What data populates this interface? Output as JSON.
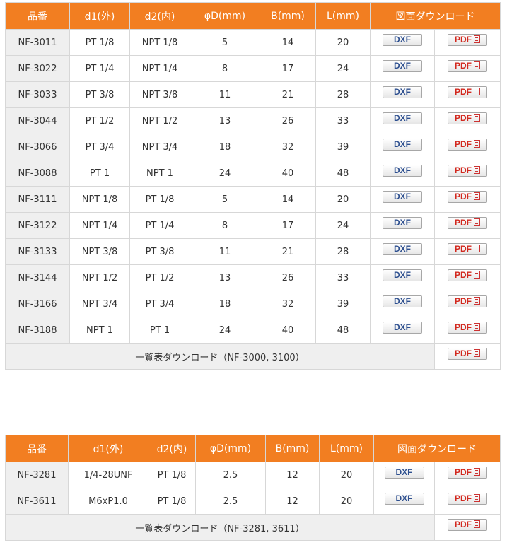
{
  "table1": {
    "headers": [
      "品番",
      "d1(外)",
      "d2(内)",
      "φD(mm)",
      "B(mm)",
      "L(mm)",
      "図面ダウンロード"
    ],
    "rows": [
      [
        "NF-3011",
        "PT 1/8",
        "NPT 1/8",
        "5",
        "14",
        "20"
      ],
      [
        "NF-3022",
        "PT 1/4",
        "NPT 1/4",
        "8",
        "17",
        "24"
      ],
      [
        "NF-3033",
        "PT 3/8",
        "NPT 3/8",
        "11",
        "21",
        "28"
      ],
      [
        "NF-3044",
        "PT 1/2",
        "NPT 1/2",
        "13",
        "26",
        "33"
      ],
      [
        "NF-3066",
        "PT 3/4",
        "NPT 3/4",
        "18",
        "32",
        "39"
      ],
      [
        "NF-3088",
        "PT 1",
        "NPT 1",
        "24",
        "40",
        "48"
      ],
      [
        "NF-3111",
        "NPT 1/8",
        "PT 1/8",
        "5",
        "14",
        "20"
      ],
      [
        "NF-3122",
        "NPT 1/4",
        "PT 1/4",
        "8",
        "17",
        "24"
      ],
      [
        "NF-3133",
        "NPT 3/8",
        "PT 3/8",
        "11",
        "21",
        "28"
      ],
      [
        "NF-3144",
        "NPT 1/2",
        "PT 1/2",
        "13",
        "26",
        "33"
      ],
      [
        "NF-3166",
        "NPT 3/4",
        "PT 3/4",
        "18",
        "32",
        "39"
      ],
      [
        "NF-3188",
        "NPT 1",
        "PT 1",
        "24",
        "40",
        "48"
      ]
    ],
    "footer_label": "一覧表ダウンロード（NF-3000, 3100）"
  },
  "table2": {
    "headers": [
      "品番",
      "d1(外)",
      "d2(内)",
      "φD(mm)",
      "B(mm)",
      "L(mm)",
      "図面ダウンロード"
    ],
    "rows": [
      [
        "NF-3281",
        "1/4-28UNF",
        "PT 1/8",
        "2.5",
        "12",
        "20"
      ],
      [
        "NF-3611",
        "M6xP1.0",
        "PT 1/8",
        "2.5",
        "12",
        "20"
      ]
    ],
    "footer_label": "一覧表ダウンロード（NF-3281, 3611）"
  },
  "buttons": {
    "dxf": "DXF",
    "pdf": "PDF"
  },
  "icons": {
    "pdf": "pdf-file-icon"
  },
  "colors": {
    "header_bg": "#f27e21",
    "header_text": "#ffffff",
    "border": "#d7d7d7",
    "stripe": "#efefef",
    "dxf_text": "#2d4f8f",
    "pdf_text": "#d2281e"
  }
}
